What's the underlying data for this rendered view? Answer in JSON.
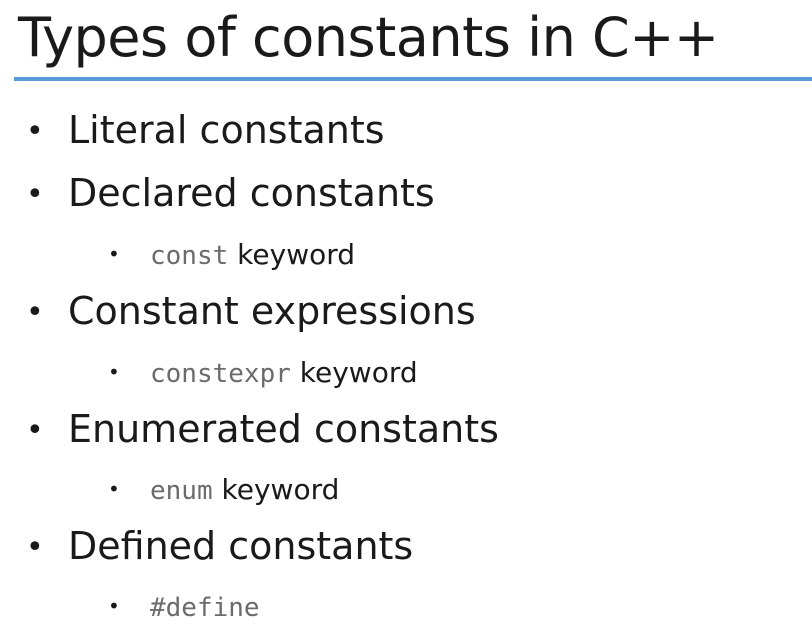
{
  "slide": {
    "title": "Types of constants in C++",
    "accent_color": "#5b9bd5",
    "items": [
      {
        "level": 1,
        "text": "Literal constants"
      },
      {
        "level": 1,
        "text": "Declared constants"
      },
      {
        "level": 2,
        "code": "const",
        "text": " keyword"
      },
      {
        "level": 1,
        "text": "Constant expressions"
      },
      {
        "level": 2,
        "code": "constexpr",
        "text": " keyword"
      },
      {
        "level": 1,
        "text": "Enumerated constants"
      },
      {
        "level": 2,
        "code": "enum",
        "text": " keyword"
      },
      {
        "level": 1,
        "text": "Defined constants"
      },
      {
        "level": 2,
        "code": "#define",
        "text": ""
      }
    ]
  }
}
